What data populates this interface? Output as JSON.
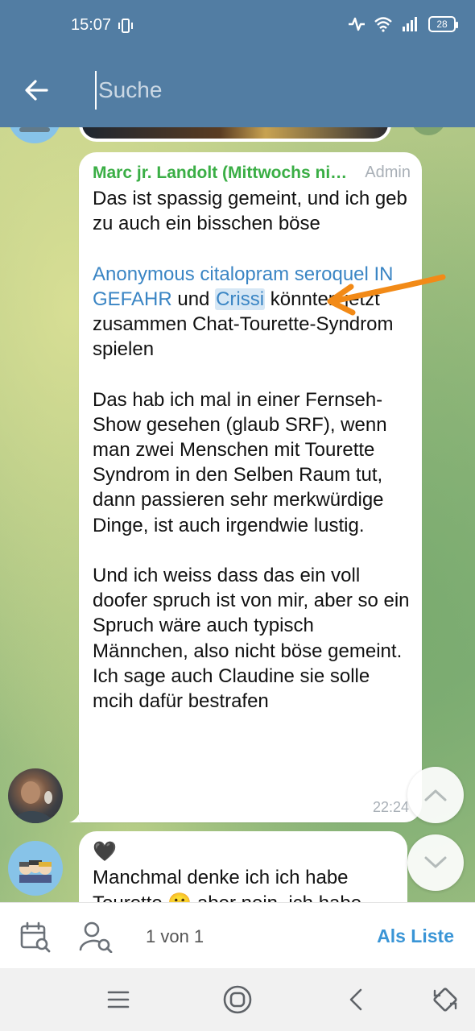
{
  "status_bar": {
    "time": "15:07",
    "battery": "28"
  },
  "header": {
    "back_icon": "arrow-left-icon",
    "search_placeholder": "Suche",
    "search_value": ""
  },
  "message": {
    "sender": "Marc jr. Landolt (Mittwochs nicht erreichbar)",
    "sender_display": "Marc jr. Landolt (Mittwochs ni…",
    "role": "Admin",
    "para1": "Das ist spassig gemeint, und ich geb zu auch ein bisschen böse",
    "mention1": "Anonymous citalopram seroquel IN GEFAHR",
    "and": " und ",
    "mention2": "Crissi",
    "para2_rest": " könnten jetzt zusammen Chat-Tourette-Syndrom spielen",
    "para3": "Das hab ich mal in einer Fernseh-Show gesehen (glaub SRF), wenn man zwei Menschen mit Tourette Syndrom in den Selben Raum tut, dann passieren sehr merkwürdige Dinge, ist auch irgendwie lustig.",
    "para4": "Und ich weiss dass das ein voll doofer spruch ist von mir, aber so ein Spruch wäre auch typisch Männchen, also nicht böse gemeint. Ich sage auch Claudine sie solle mcih dafür bestrafen",
    "time": "22:24"
  },
  "next_message": {
    "line1": "🖤",
    "line2": "Manchmal denke ich ich habe",
    "line3": "Tourette 🤫 aber nein, ich habe"
  },
  "bottom_bar": {
    "counter": "1 von 1",
    "list_button": "Als Liste"
  },
  "colors": {
    "header": "#527da3",
    "sender": "#3aae45",
    "mention": "#3a85c4",
    "arrow": "#f28a17",
    "list_button": "#3a95d6"
  }
}
